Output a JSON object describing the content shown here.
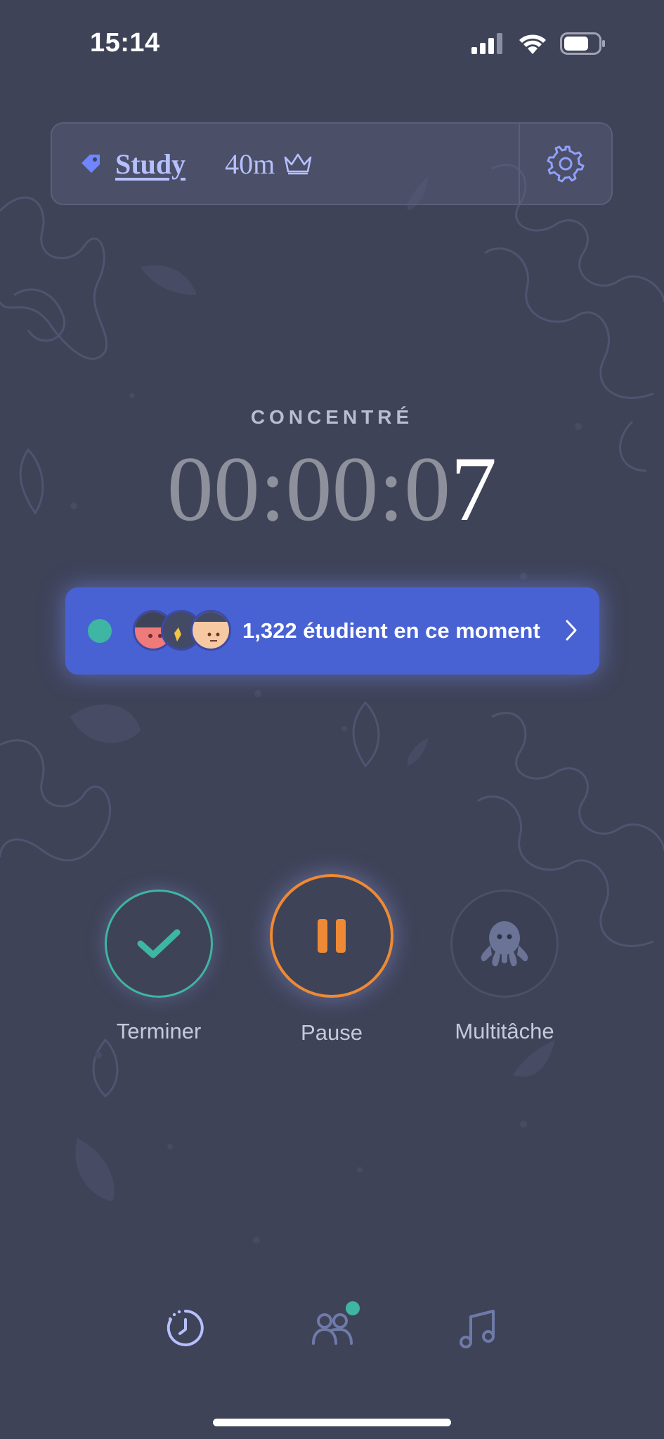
{
  "status_bar": {
    "time": "15:14",
    "icons": [
      "signal-icon",
      "wifi-icon",
      "battery-icon"
    ]
  },
  "header": {
    "tag_icon": "tag-icon",
    "tag_name": "Study",
    "duration": "40m",
    "crown_icon": "crown-icon",
    "settings_icon": "gear-icon"
  },
  "timer": {
    "mode": "CONCENTRÉ",
    "dim_part": "00:00:0",
    "bright_part": "7"
  },
  "live_banner": {
    "text": "1,322 étudient en ce moment",
    "icon": "chevron-right-icon"
  },
  "actions": {
    "finish_label": "Terminer",
    "pause_label": "Pause",
    "multitask_label": "Multitâche"
  },
  "bottom_nav": {
    "items": [
      "timer-icon",
      "friends-icon",
      "music-icon"
    ]
  },
  "colors": {
    "background": "#3e4358",
    "accent_blue": "#4862d4",
    "teal": "#3fb5a3",
    "orange": "#ee8a35",
    "lavender": "#b6c0ff"
  }
}
